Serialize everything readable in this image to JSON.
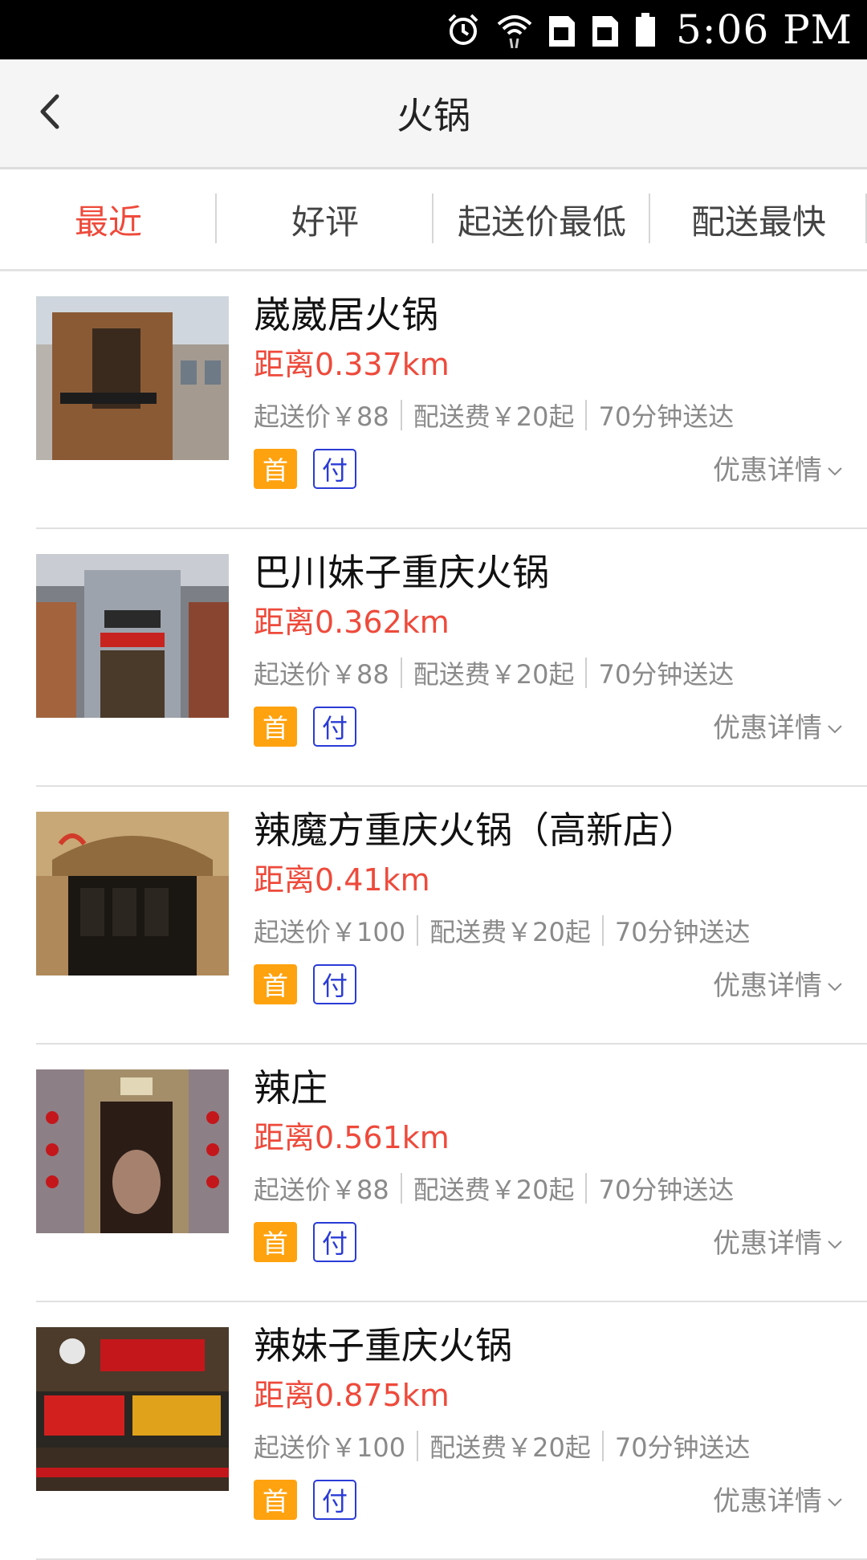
{
  "status_bar": {
    "time": "5:06 PM",
    "icons": [
      "alarm-icon",
      "wifi-icon",
      "sim-card-icon",
      "sim-card-icon",
      "battery-icon"
    ]
  },
  "header": {
    "title": "火锅",
    "back_icon": "chevron-left-icon"
  },
  "sort_tabs": [
    {
      "label": "最近",
      "active": true
    },
    {
      "label": "好评",
      "active": false
    },
    {
      "label": "起送价最低",
      "active": false
    },
    {
      "label": "配送最快",
      "active": false
    }
  ],
  "colors": {
    "accent_red": "#ee4a3b",
    "badge_orange": "#ffa20f",
    "badge_blue": "#2a3bd6"
  },
  "restaurants": [
    {
      "name": "崴崴居火锅",
      "distance": "距离0.337km",
      "min_order": "起送价￥88",
      "delivery_fee": "配送费￥20起",
      "delivery_time": "70分钟送达",
      "badge_first": "首",
      "badge_pay": "付",
      "promo": "优惠详情"
    },
    {
      "name": "巴川妹子重庆火锅",
      "distance": "距离0.362km",
      "min_order": "起送价￥88",
      "delivery_fee": "配送费￥20起",
      "delivery_time": "70分钟送达",
      "badge_first": "首",
      "badge_pay": "付",
      "promo": "优惠详情"
    },
    {
      "name": "辣魔方重庆火锅（高新店）",
      "distance": "距离0.41km",
      "min_order": "起送价￥100",
      "delivery_fee": "配送费￥20起",
      "delivery_time": "70分钟送达",
      "badge_first": "首",
      "badge_pay": "付",
      "promo": "优惠详情"
    },
    {
      "name": "辣庄",
      "distance": "距离0.561km",
      "min_order": "起送价￥88",
      "delivery_fee": "配送费￥20起",
      "delivery_time": "70分钟送达",
      "badge_first": "首",
      "badge_pay": "付",
      "promo": "优惠详情"
    },
    {
      "name": "辣妹子重庆火锅",
      "distance": "距离0.875km",
      "min_order": "起送价￥100",
      "delivery_fee": "配送费￥20起",
      "delivery_time": "70分钟送达",
      "badge_first": "首",
      "badge_pay": "付",
      "promo": "优惠详情"
    }
  ]
}
